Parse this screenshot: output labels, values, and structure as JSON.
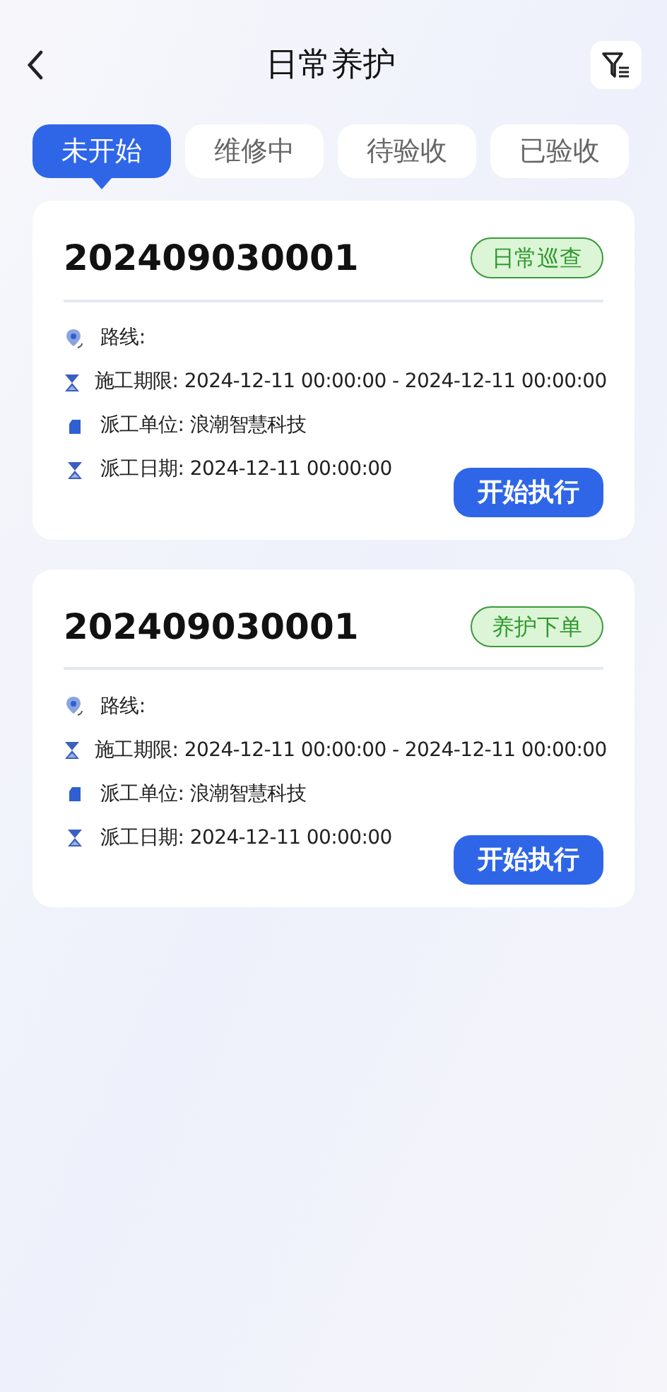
{
  "header": {
    "title": "日常养护"
  },
  "tabs": [
    {
      "label": "未开始",
      "selected": true
    },
    {
      "label": "维修中",
      "selected": false
    },
    {
      "label": "待验收",
      "selected": false
    },
    {
      "label": "已验收",
      "selected": false
    }
  ],
  "cards": [
    {
      "number": "202409030001",
      "tag": "日常巡查",
      "fields": [
        {
          "kind": "route",
          "text": "路线:"
        },
        {
          "kind": "time",
          "text": "施工期限: 2024-12-11 00:00:00 - 2024-12-11 00:00:00"
        },
        {
          "kind": "unit",
          "text": "派工单位: 浪潮智慧科技"
        },
        {
          "kind": "time",
          "text": "派工日期: 2024-12-11 00:00:00"
        }
      ],
      "button": "开始执行"
    },
    {
      "number": "202409030001",
      "tag": "养护下单",
      "fields": [
        {
          "kind": "route",
          "text": "路线:"
        },
        {
          "kind": "time",
          "text": "施工期限: 2024-12-11 00:00:00 - 2024-12-11 00:00:00"
        },
        {
          "kind": "unit",
          "text": "派工单位: 浪潮智慧科技"
        },
        {
          "kind": "time",
          "text": "派工日期: 2024-12-11 00:00:00"
        }
      ],
      "button": "开始执行"
    }
  ]
}
